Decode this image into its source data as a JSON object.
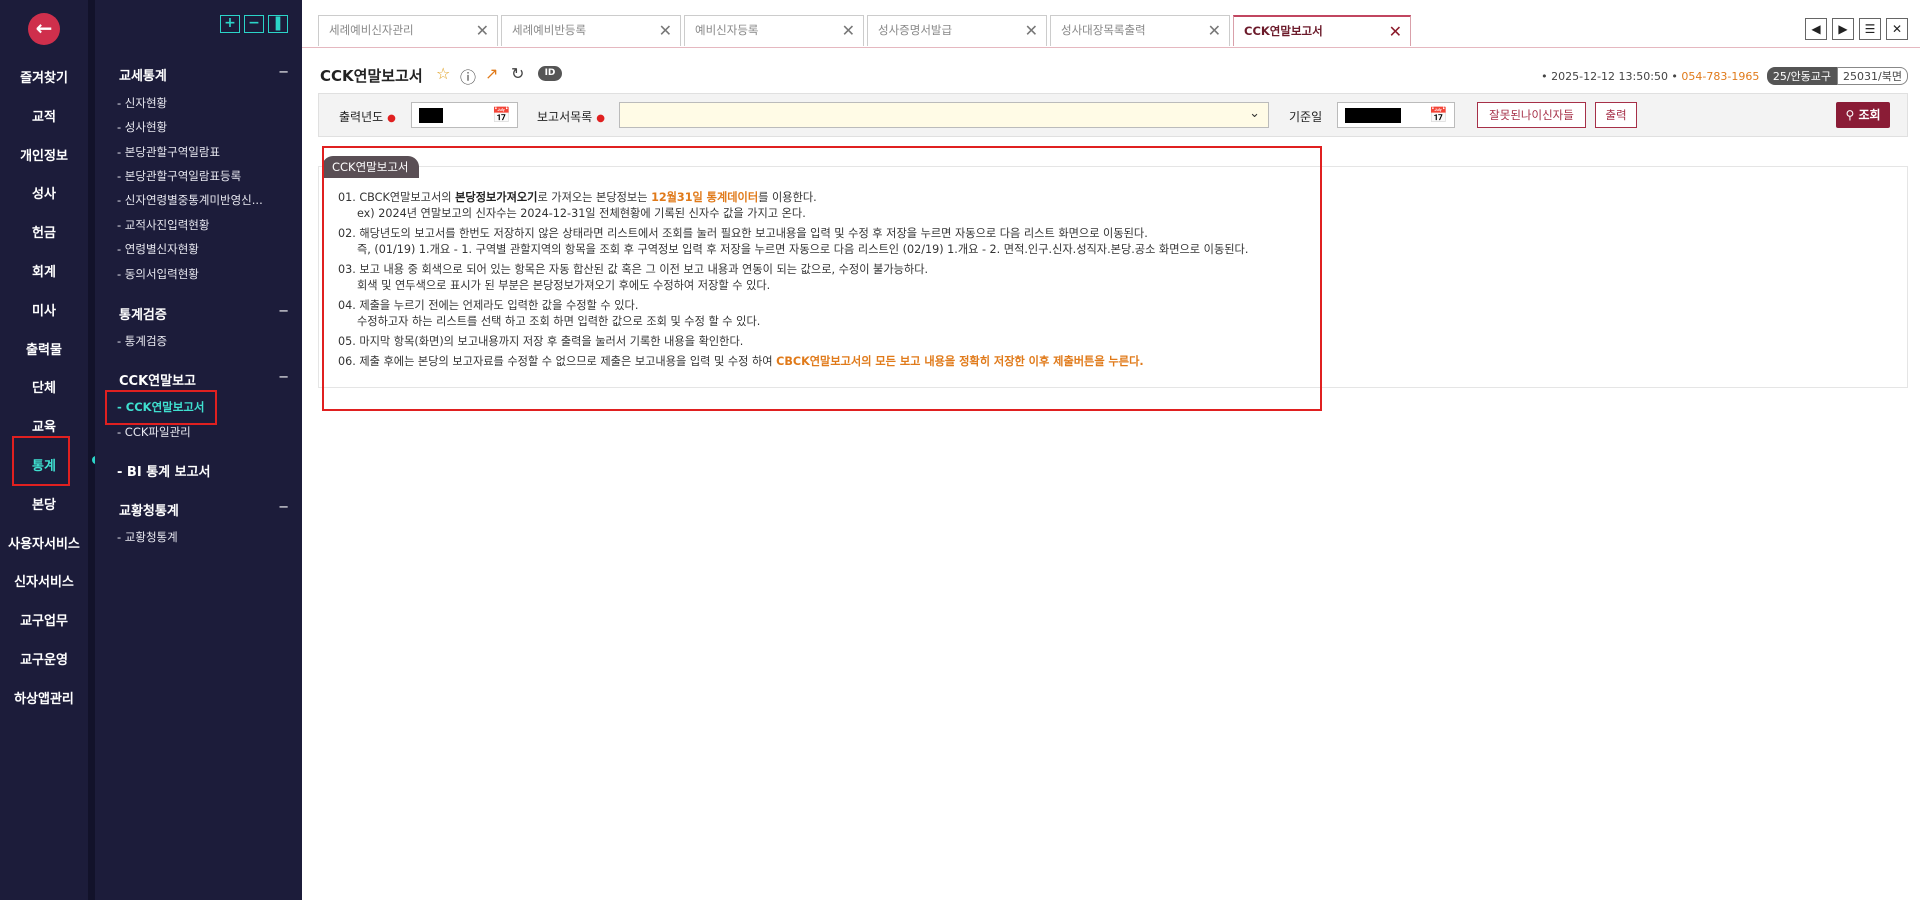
{
  "nav_main": {
    "items": [
      "즐겨찾기",
      "교적",
      "개인정보",
      "성사",
      "헌금",
      "회계",
      "미사",
      "출력물",
      "단체",
      "교육",
      "통계",
      "본당",
      "사용자서비스",
      "신자서비스",
      "교구업무",
      "교구운영",
      "하상앱관리"
    ],
    "active": "통계"
  },
  "nav_sub": {
    "sections": [
      {
        "title": "교세통계",
        "items": [
          "- 신자현황",
          "- 성사현황",
          "- 본당관할구역일람표",
          "- 본당관할구역일람표등록",
          "- 신자연령별중통계미반영신...",
          "- 교적사진입력현황",
          "- 연령별신자현황",
          "- 동의서입력현황"
        ]
      },
      {
        "title": "통계검증",
        "items": [
          "- 통계검증"
        ]
      },
      {
        "title": "CCK연말보고",
        "items": [
          "- CCK연말보고서",
          "- CCK파일관리"
        ]
      },
      {
        "title": "- BI 통계 보고서",
        "items": []
      },
      {
        "title": "교황청통계",
        "items": [
          "- 교황청통계"
        ]
      }
    ],
    "minus": "−"
  },
  "tabs": [
    {
      "label": "세례예비신자관리"
    },
    {
      "label": "세례예비반등록"
    },
    {
      "label": "예비신자등록"
    },
    {
      "label": "성사증명서발급"
    },
    {
      "label": "성사대장목록출력"
    },
    {
      "label": "CCK연말보고서"
    }
  ],
  "page": {
    "title": "CCK연말보고서",
    "id_badge": "ID"
  },
  "status": {
    "datetime": "• 2025-12-12 13:50:50 •",
    "phone": "054-783-1965",
    "parish": "25/안동교구",
    "code": "25031/북면"
  },
  "search": {
    "year_label": "출력년도",
    "list_label": "보고서목록",
    "base_date_label": "기준일",
    "wrong_age_button": "잘못된나이신자들",
    "print_button": "출력",
    "search_button": "조회"
  },
  "panel": {
    "label": "CCK연말보고서",
    "notes": [
      {
        "parts": [
          "01. CBCK연말보고서의 ",
          "본당정보가져오기",
          "로 가져오는 본당정보는 ",
          "12월31일 통계데이터",
          "를 이용한다."
        ],
        "sub": "ex) 2024년 연말보고의 신자수는 2024-12-31일 전체현황에 기록된 신자수 값을 가지고 온다."
      },
      {
        "text": "02. 해당년도의 보고서를 한번도 저장하지 않은 상태라면 리스트에서 조회를 눌러 필요한 보고내용을 입력 및 수정 후 저장을 누르면 자동으로 다음 리스트 화면으로 이동된다.",
        "sub": "즉, (01/19) 1.개요 - 1. 구역별 관할지역의 항목을 조회 후 구역정보 입력 후 저장을 누르면 자동으로 다음 리스트인 (02/19) 1.개요 - 2. 면적.인구.신자.성직자.본당.공소 화면으로 이동된다."
      },
      {
        "text": "03. 보고 내용 중 회색으로 되어 있는 항목은 자동 합산된 값 혹은 그 이전 보고 내용과 연동이 되는 값으로, 수정이 불가능하다.",
        "sub": "회색 및 연두색으로 표시가 된 부분은 본당정보가져오기 후에도 수정하여 저장할 수 있다."
      },
      {
        "text": "04. 제출을 누르기 전에는 언제라도 입력한 값을 수정할 수 있다.",
        "sub": "수정하고자 하는 리스트를 선택 하고 조회 하면 입력한 값으로 조회 및 수정 할 수 있다."
      },
      {
        "text": "05. 마지막 항목(화면)의 보고내용까지 저장 후 출력을 눌러서 기록한 내용을 확인한다."
      },
      {
        "parts6": [
          "06. 제출 후에는 본당의 보고자료를 수정할 수 없으므로 제출은 보고내용을 입력 및 수정 하여 ",
          "CBCK연말보고서의 모든 보고 내용을 정확히 저장한 이후 제출버튼을 누른다."
        ]
      }
    ]
  },
  "colors": {
    "nav_bg": "#1c1c3a",
    "accent": "#8a1c36",
    "highlight": "#e02020",
    "active_text": "#3fe0d0",
    "orange": "#e07a1a"
  }
}
